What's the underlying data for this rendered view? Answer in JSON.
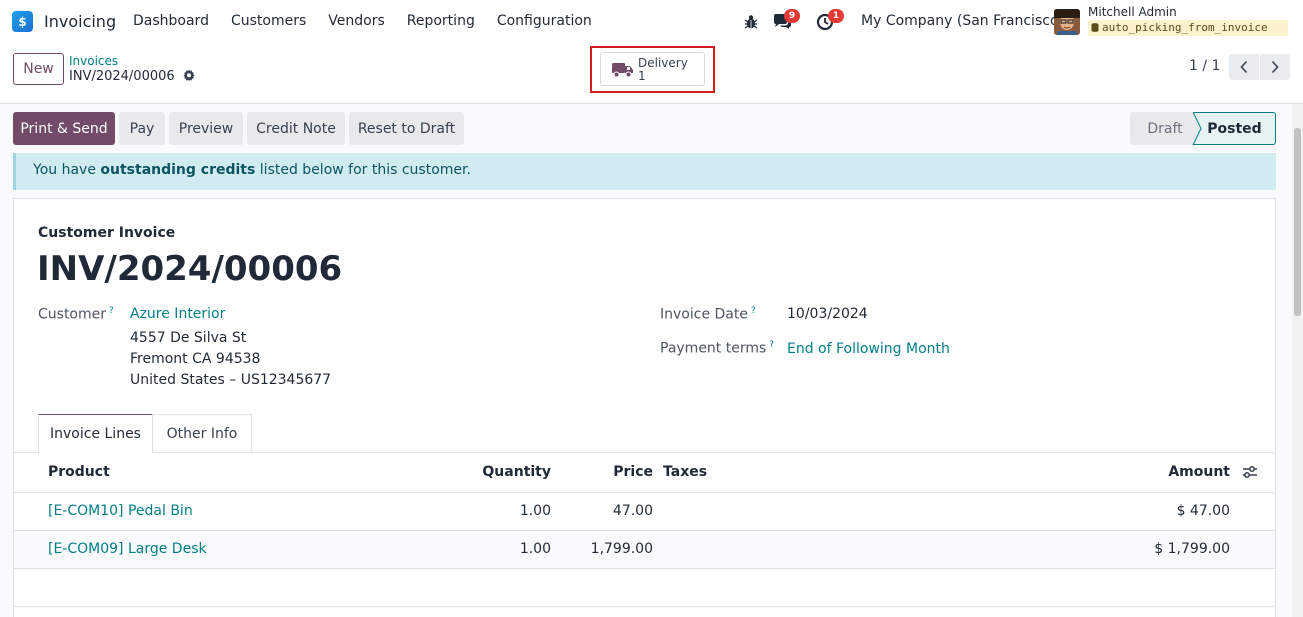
{
  "navbar": {
    "app_name": "Invoicing",
    "menu": [
      "Dashboard",
      "Customers",
      "Vendors",
      "Reporting",
      "Configuration"
    ],
    "chat_badge": "9",
    "activity_badge": "1",
    "company": "My Company (San Francisco)",
    "user_name": "Mitchell Admin",
    "db_name": "auto_picking_from_invoice"
  },
  "control": {
    "new_label": "New",
    "breadcrumb_parent": "Invoices",
    "breadcrumb_current": "INV/2024/00006",
    "smart_label": "Delivery",
    "smart_count": "1",
    "pager": "1 / 1"
  },
  "actions": {
    "print_send": "Print & Send",
    "pay": "Pay",
    "preview": "Preview",
    "credit_note": "Credit Note",
    "reset_draft": "Reset to Draft"
  },
  "status": {
    "draft": "Draft",
    "posted": "Posted"
  },
  "alert": {
    "prefix": "You have ",
    "bold": "outstanding credits",
    "suffix": " listed below for this customer."
  },
  "form": {
    "kind": "Customer Invoice",
    "name": "INV/2024/00006",
    "customer_label": "Customer",
    "customer_name": "Azure Interior",
    "address_1": "4557 De Silva St",
    "address_2": "Fremont CA 94538",
    "address_3": "United States – US12345677",
    "invoice_date_label": "Invoice Date",
    "invoice_date": "10/03/2024",
    "payment_terms_label": "Payment terms",
    "payment_terms": "End of Following Month",
    "help_mark": "?"
  },
  "tabs": [
    "Invoice Lines",
    "Other Info"
  ],
  "table": {
    "headers": {
      "product": "Product",
      "quantity": "Quantity",
      "price": "Price",
      "taxes": "Taxes",
      "amount": "Amount"
    },
    "rows": [
      {
        "product": "[E-COM10] Pedal Bin",
        "quantity": "1.00",
        "price": "47.00",
        "taxes": "",
        "amount": "$ 47.00"
      },
      {
        "product": "[E-COM09] Large Desk",
        "quantity": "1.00",
        "price": "1,799.00",
        "taxes": "",
        "amount": "$ 1,799.00"
      }
    ]
  },
  "colors": {
    "brand": "#714b67",
    "link": "#017e84",
    "alert_bg": "#d1ecf1",
    "highlight_box": "#d21e1e",
    "badge": "#e53935"
  },
  "icons": [
    "app-icon",
    "bug-icon",
    "chat-icon",
    "clock-icon",
    "gear-icon",
    "truck-icon",
    "chevron-left-icon",
    "chevron-right-icon",
    "column-settings-icon"
  ]
}
